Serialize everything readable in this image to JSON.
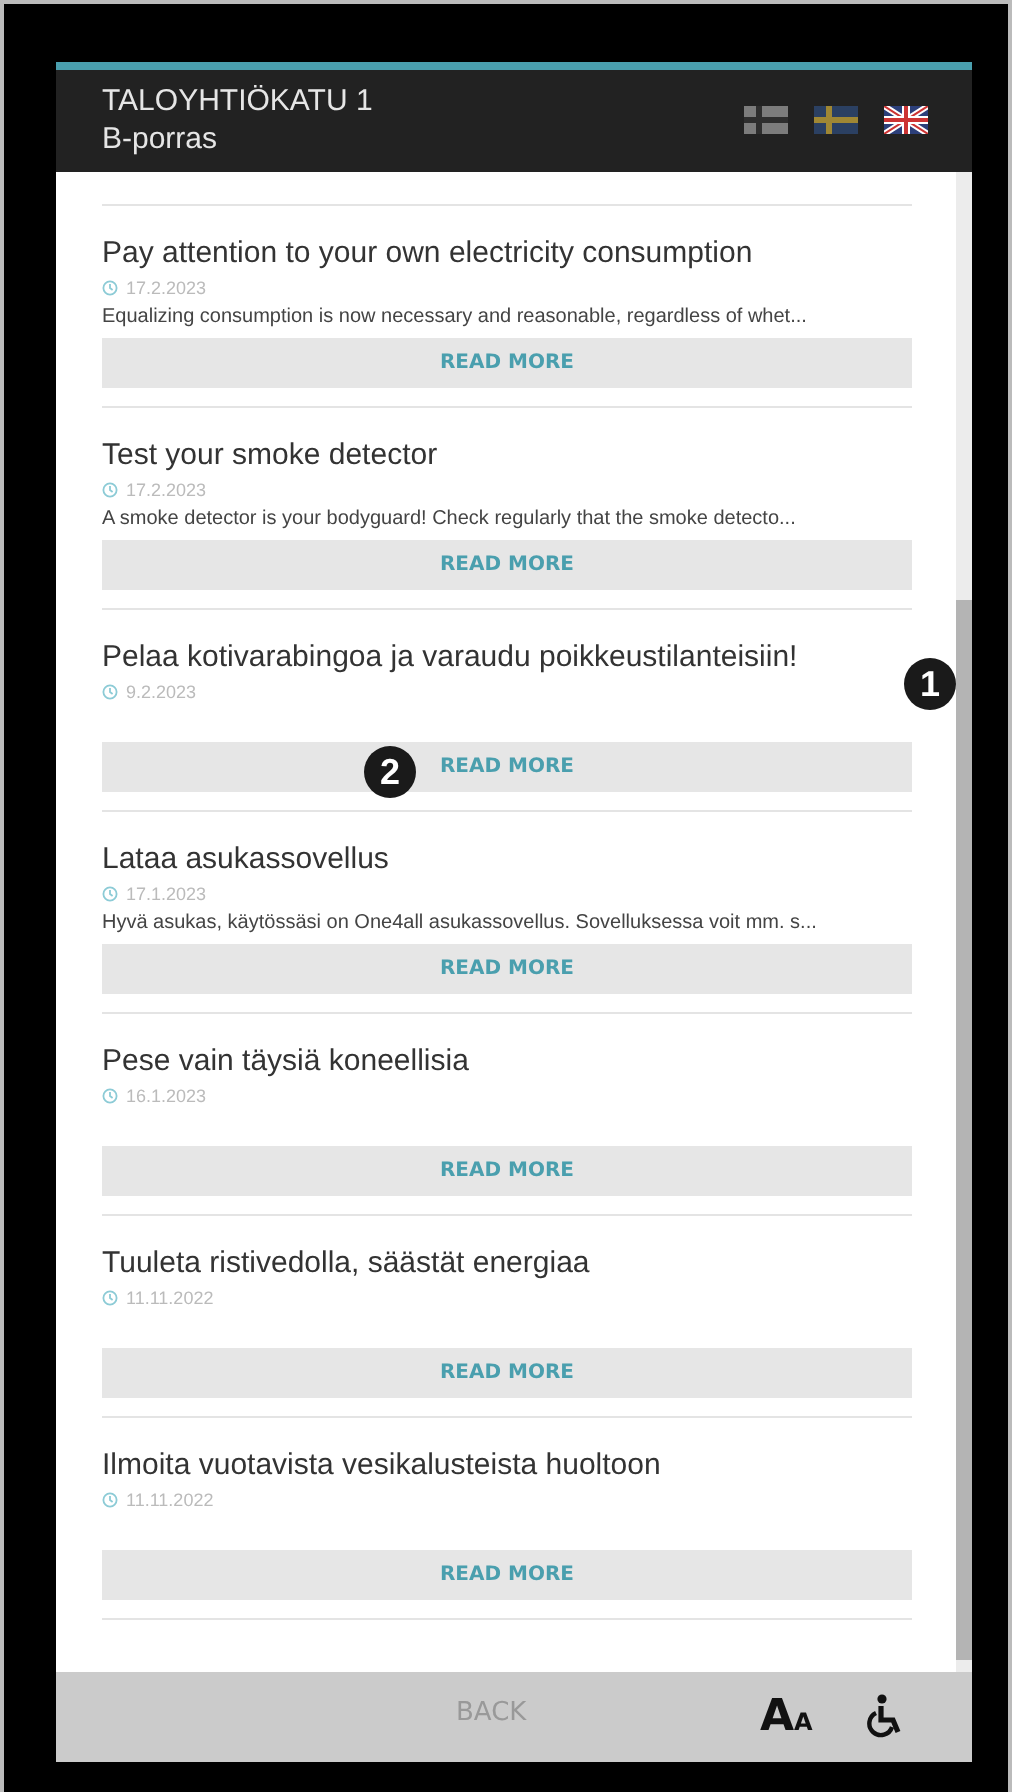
{
  "header": {
    "title": "TALOYHTIÖKATU 1",
    "subtitle": "B-porras",
    "languages": [
      {
        "kind": "fi",
        "selected": false
      },
      {
        "kind": "sv",
        "selected": false
      },
      {
        "kind": "en",
        "selected": true
      }
    ]
  },
  "news": [
    {
      "title": "Pay attention to your own electricity consumption",
      "date": "17.2.2023",
      "excerpt": "Equalizing consumption is now necessary and reasonable, regardless of whet...",
      "button": "READ MORE"
    },
    {
      "title": "Test your smoke detector",
      "date": "17.2.2023",
      "excerpt": "A smoke detector is your bodyguard! Check regularly that the smoke detecto...",
      "button": "READ MORE"
    },
    {
      "title": "Pelaa kotivarabingoa ja varaudu poikkeustilanteisiin!",
      "date": "9.2.2023",
      "button": "READ MORE"
    },
    {
      "title": "Lataa asukassovellus",
      "date": "17.1.2023",
      "excerpt": "Hyvä asukas, käytössäsi on One4all asukassovellus. Sovelluksessa voit mm. s...",
      "button": "READ MORE"
    },
    {
      "title": "Pese vain täysiä koneellisia",
      "date": "16.1.2023",
      "button": "READ MORE"
    },
    {
      "title": "Tuuleta ristivedolla, säästät energiaa",
      "date": "11.11.2022",
      "button": "READ MORE"
    },
    {
      "title": "Ilmoita vuotavista vesikalusteista huoltoon",
      "date": "11.11.2022",
      "button": "READ MORE"
    }
  ],
  "footer": {
    "back": "BACK",
    "text_size": {
      "large": "A",
      "small": "A"
    }
  },
  "callouts": [
    {
      "label": "1"
    },
    {
      "label": "2"
    }
  ]
}
